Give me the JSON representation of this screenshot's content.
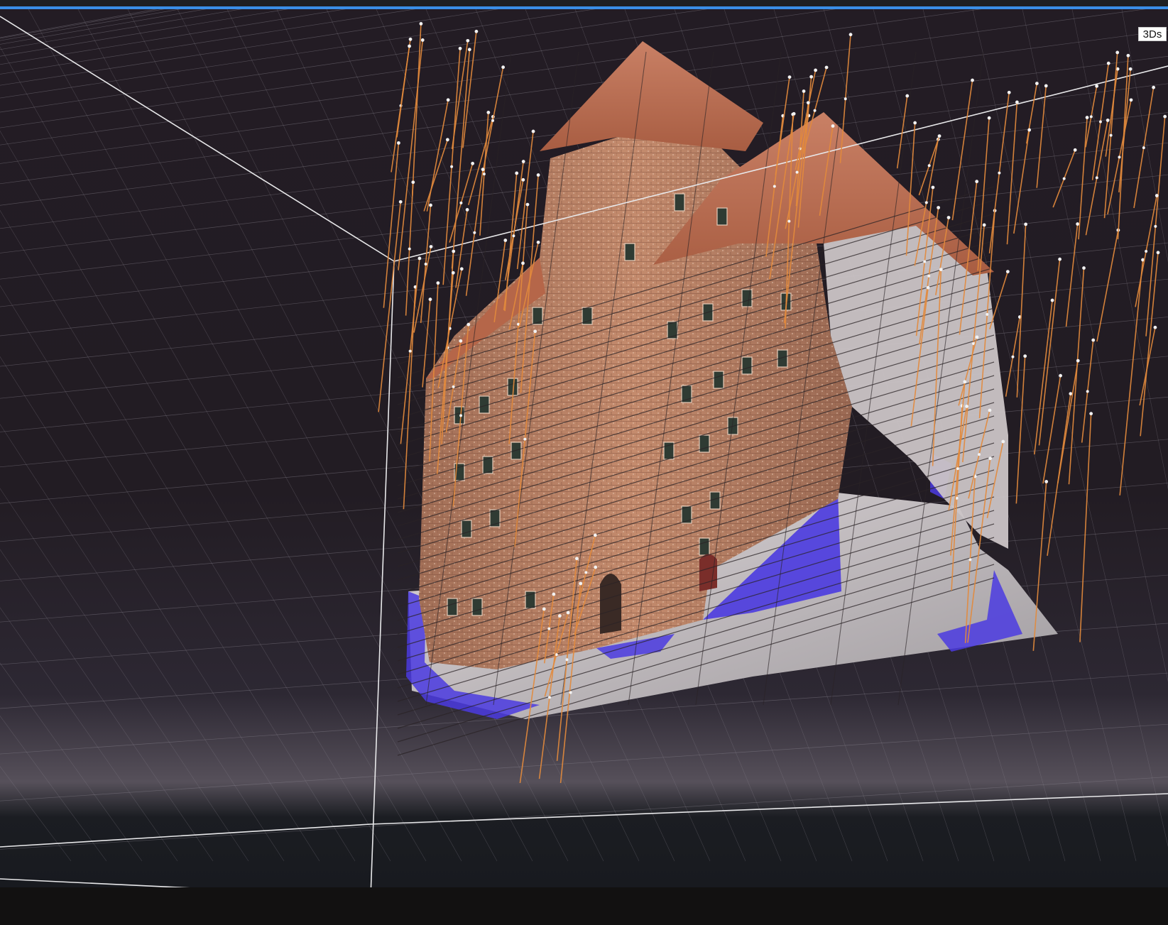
{
  "viewport": {
    "view_label": "3Ds"
  },
  "colors": {
    "accent_bar": "#3a8ee6",
    "background": "#221c23",
    "grid_line": "#8a8590",
    "bounding_box": "#e8e8ea",
    "camera_line": "#e38a3c",
    "wall_brick": "#b07a5e",
    "roof": "#b8684a",
    "mesh_gray": "#c8c2c4",
    "ground_blue": "#4b3be0"
  },
  "icons": {
    "camera_marker": "camera-marker-icon"
  }
}
